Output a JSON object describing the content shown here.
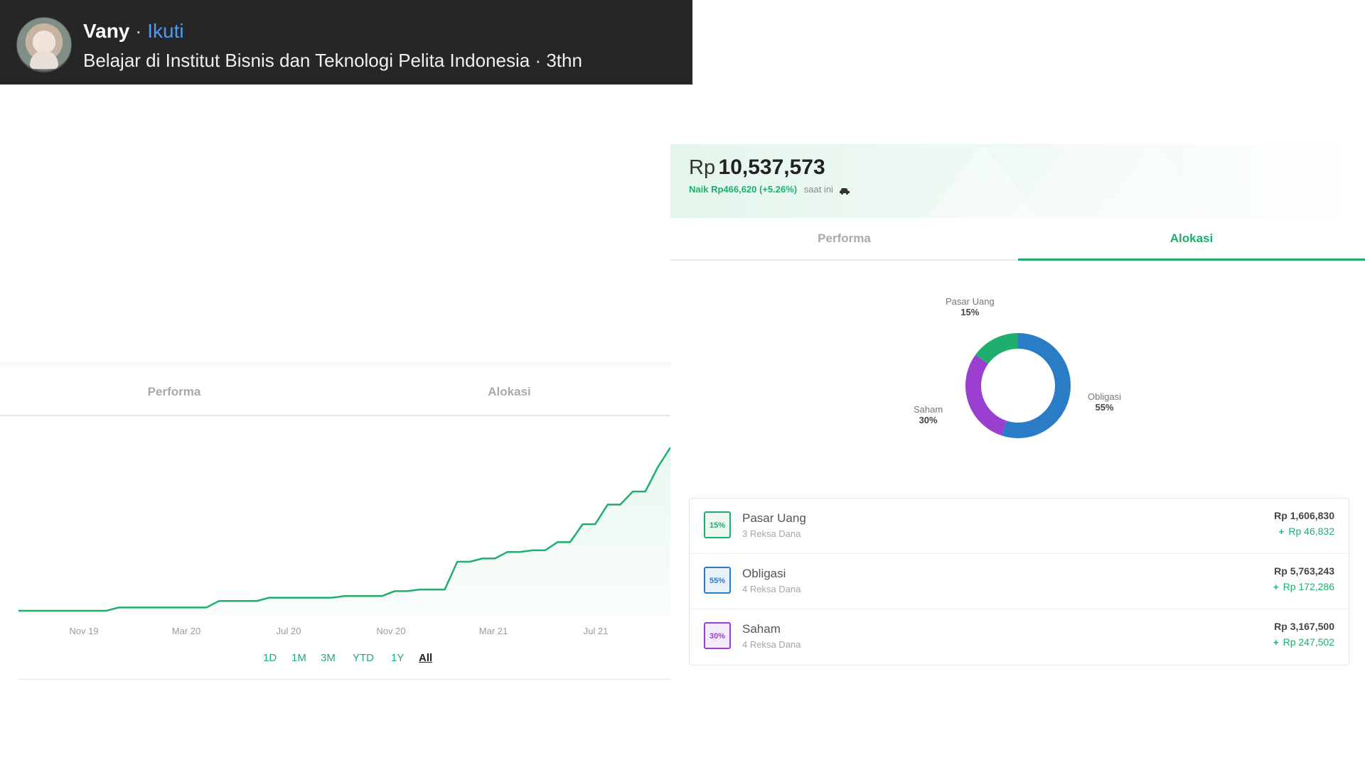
{
  "post": {
    "name": "Vany",
    "separator": "·",
    "follow_label": "Ikuti",
    "subtitle": "Belajar di Institut Bisnis dan Teknologi Pelita Indonesia · 3thn"
  },
  "left_panel": {
    "tabs": [
      {
        "label": "Performa",
        "active": true
      },
      {
        "label": "Alokasi",
        "active": false
      }
    ],
    "ranges": [
      {
        "label": "1D",
        "active": false
      },
      {
        "label": "1M",
        "active": false
      },
      {
        "label": "3M",
        "active": false
      },
      {
        "label": "YTD",
        "active": false
      },
      {
        "label": "1Y",
        "active": false
      },
      {
        "label": "All",
        "active": true
      }
    ]
  },
  "right_panel": {
    "balance": {
      "currency": "Rp",
      "amount": "10,537,573",
      "change": "Naik Rp466,620 (+5.26%)",
      "now_label": "saat ini"
    },
    "tabs": [
      {
        "label": "Performa",
        "active": false
      },
      {
        "label": "Alokasi",
        "active": true
      }
    ],
    "allocations": [
      {
        "name": "Pasar Uang",
        "percent_label": "15%",
        "funds": "3 Reksa Dana",
        "amount": "Rp 1,606,830",
        "gain": "Rp 46,832",
        "color": "#1fae6e"
      },
      {
        "name": "Obligasi",
        "percent_label": "55%",
        "funds": "4 Reksa Dana",
        "amount": "Rp 5,763,243",
        "gain": "Rp 172,286",
        "color": "#2a7cc7"
      },
      {
        "name": "Saham",
        "percent_label": "30%",
        "funds": "4 Reksa Dana",
        "amount": "Rp 3,167,500",
        "gain": "Rp 247,502",
        "color": "#9b3fd0"
      }
    ]
  },
  "chart_data": [
    {
      "type": "line",
      "x_tick_labels": [
        "Nov 19",
        "Mar 20",
        "Jul 20",
        "Nov 20",
        "Mar 21",
        "Jul 21"
      ],
      "x": [
        0,
        0.25,
        0.5,
        0.75,
        1.0,
        1.25,
        1.5,
        1.75,
        2.0,
        2.25,
        2.5,
        2.75,
        3.0,
        3.25,
        3.5,
        3.75,
        4.0,
        4.25,
        4.5,
        4.75,
        5.0,
        5.25,
        5.5,
        5.75,
        6.0,
        6.25,
        6.5,
        6.75,
        7.0,
        7.25,
        7.5,
        7.75,
        8.0,
        8.25,
        8.5,
        8.75,
        9.0,
        9.25,
        9.5,
        9.75,
        10.0,
        10.25,
        10.5,
        10.75,
        11.0,
        11.25,
        11.5,
        11.75,
        12.0,
        12.25,
        12.5,
        12.75,
        13.0
      ],
      "series": [
        {
          "color": "#1fae6e",
          "values": [
            0.0,
            0.0,
            0.0,
            0.0,
            0.0,
            0.0,
            0.0,
            0.0,
            0.02,
            0.02,
            0.02,
            0.02,
            0.02,
            0.02,
            0.02,
            0.02,
            0.06,
            0.06,
            0.06,
            0.06,
            0.08,
            0.08,
            0.08,
            0.08,
            0.08,
            0.08,
            0.09,
            0.09,
            0.09,
            0.09,
            0.12,
            0.12,
            0.13,
            0.13,
            0.13,
            0.3,
            0.3,
            0.32,
            0.32,
            0.36,
            0.36,
            0.37,
            0.37,
            0.42,
            0.42,
            0.53,
            0.53,
            0.65,
            0.65,
            0.73,
            0.73,
            0.88,
            1.0
          ]
        }
      ],
      "xlabel": "",
      "ylabel": "",
      "grid": false
    },
    {
      "type": "pie",
      "donut": true,
      "categories": [
        "Pasar Uang",
        "Obligasi",
        "Saham"
      ],
      "values": [
        15,
        55,
        30
      ],
      "labels": [
        "15%",
        "55%",
        "30%"
      ],
      "colors": [
        "#1fae6e",
        "#2a7cc7",
        "#9b3fd0"
      ]
    }
  ]
}
